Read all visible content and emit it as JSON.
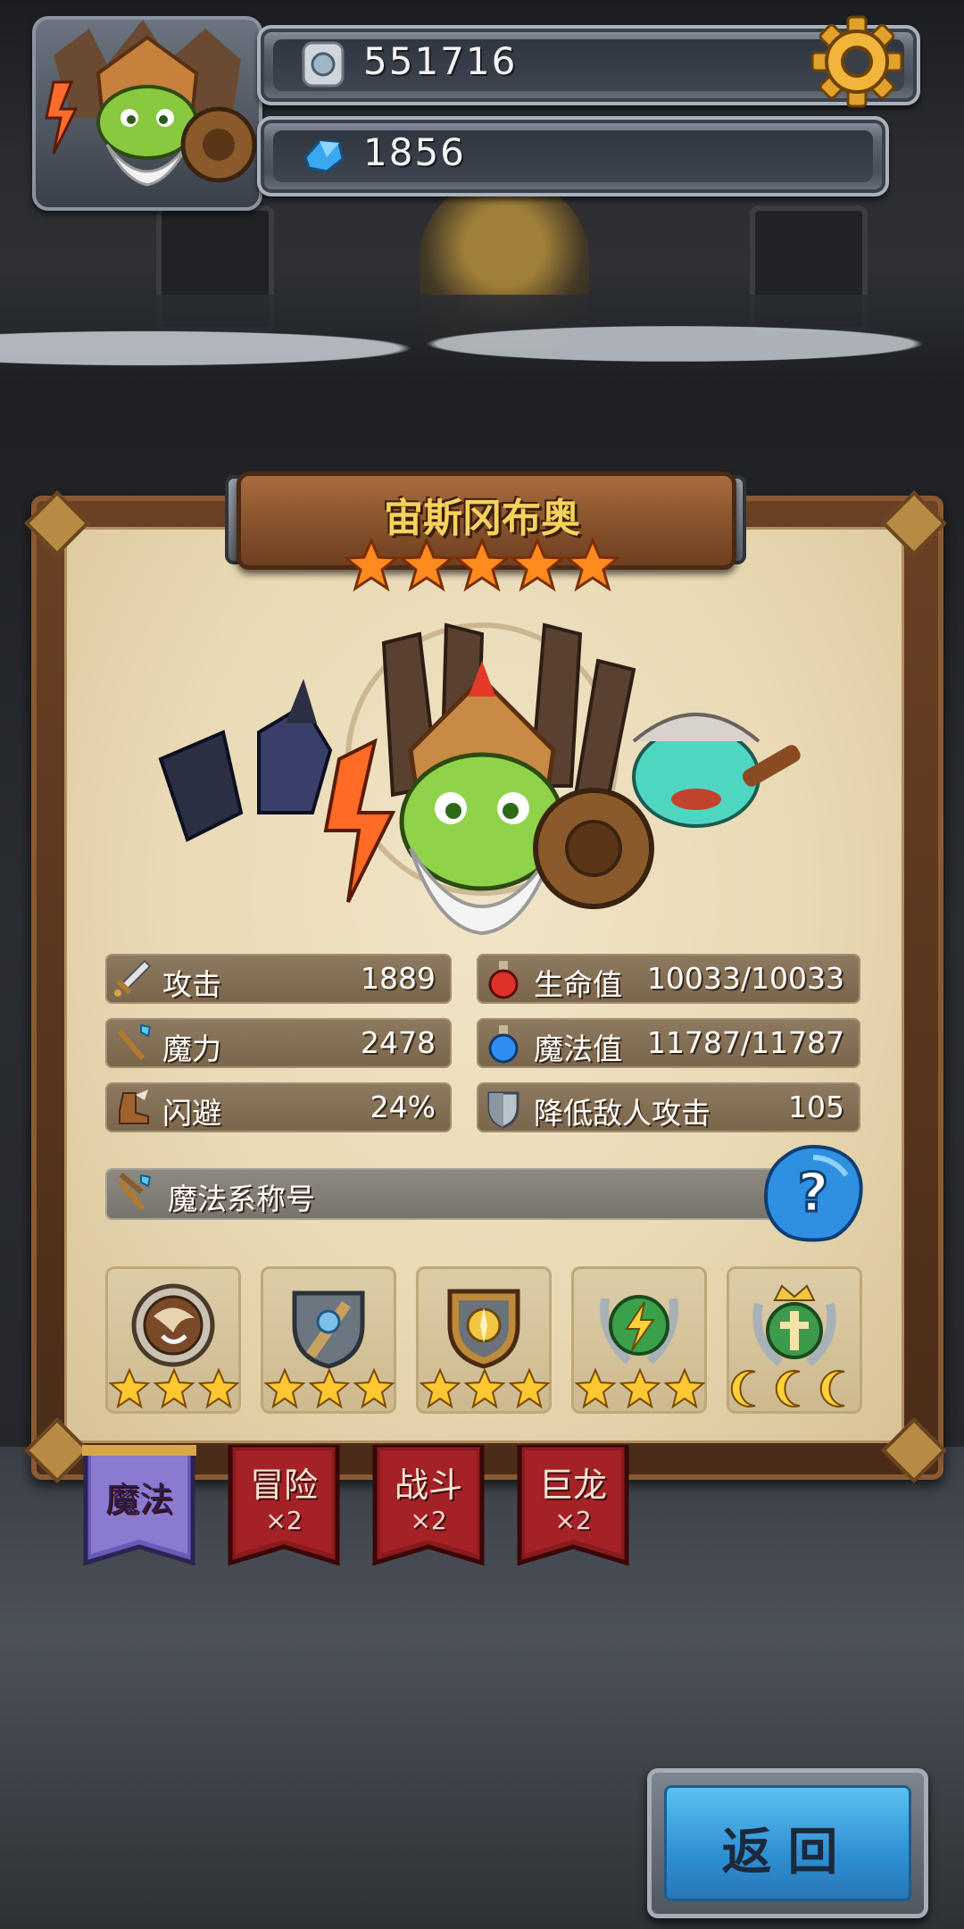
{
  "hud": {
    "gold_value": "551716",
    "gem_value": "1856",
    "gold_icon": "silver-coin-icon",
    "gem_icon": "blue-crystal-icon",
    "settings_icon": "gear-icon"
  },
  "hero": {
    "name": "宙斯冈布奥",
    "stars": 5
  },
  "stats": {
    "attack": {
      "label": "攻击",
      "value": "1889",
      "icon": "sword-icon"
    },
    "magic": {
      "label": "魔力",
      "value": "2478",
      "icon": "magic-staff-icon"
    },
    "dodge": {
      "label": "闪避",
      "value": "24%",
      "icon": "winged-boot-icon"
    },
    "hp": {
      "label": "生命值",
      "value": "10033/10033",
      "icon": "red-potion-icon"
    },
    "mp": {
      "label": "魔法值",
      "value": "11787/11787",
      "icon": "blue-potion-icon"
    },
    "defense": {
      "label": "降低敌人攻击",
      "value": "105",
      "icon": "shield-icon"
    }
  },
  "title_bar": {
    "label": "魔法系称号",
    "icon": "magic-staff-icon",
    "help_icon": "question-icon"
  },
  "badges": [
    {
      "icon": "horn-badge-icon",
      "stars": 3,
      "star_type": "star"
    },
    {
      "icon": "shield-badge-icon",
      "stars": 3,
      "star_type": "star"
    },
    {
      "icon": "compass-badge-icon",
      "stars": 3,
      "star_type": "star"
    },
    {
      "icon": "lightning-badge-icon",
      "stars": 3,
      "star_type": "star"
    },
    {
      "icon": "crown-badge-icon",
      "stars": 3,
      "star_type": "moon"
    }
  ],
  "tabs": [
    {
      "label": "魔法",
      "sub": "",
      "active": true
    },
    {
      "label": "冒险",
      "sub": "×2",
      "active": false
    },
    {
      "label": "战斗",
      "sub": "×2",
      "active": false
    },
    {
      "label": "巨龙",
      "sub": "×2",
      "active": false
    }
  ],
  "buttons": {
    "back_label": "返回"
  },
  "colors": {
    "title_gold": "#f7d25c",
    "tab_red": "#9b1f22",
    "tab_active": "#5a4a9c",
    "back_blue": "#3a9fe0"
  }
}
